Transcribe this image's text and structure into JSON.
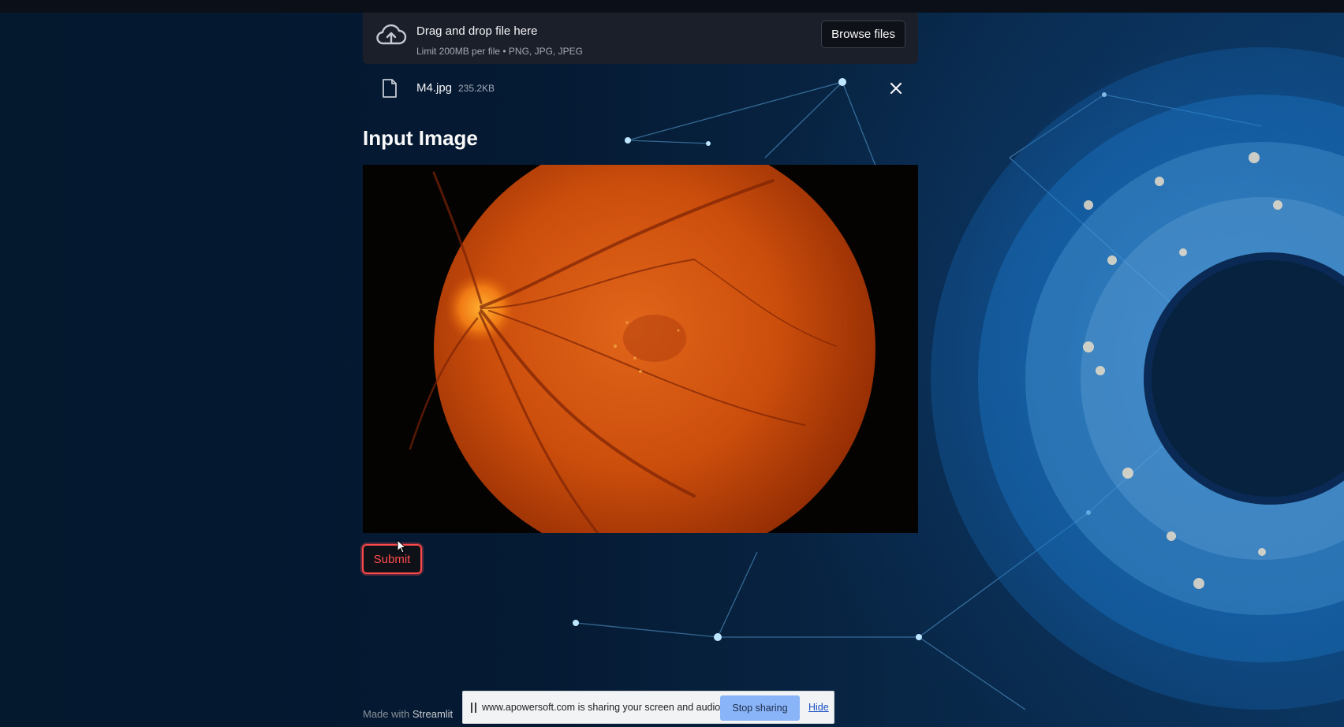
{
  "uploader": {
    "title": "Drag and drop file here",
    "limit_text": "Limit 200MB per file • PNG, JPG, JPEG",
    "browse_label": "Browse files",
    "icon": "cloud-upload-icon"
  },
  "file": {
    "name": "M4.jpg",
    "size": "235.2KB",
    "icon": "file-icon"
  },
  "main": {
    "heading": "Input Image",
    "submit_label": "Submit"
  },
  "footer": {
    "made_with": "Made with",
    "brand": "Streamlit"
  },
  "share_bar": {
    "message": "www.apowersoft.com is sharing your screen and audio.",
    "stop_label": "Stop sharing",
    "hide_label": "Hide"
  },
  "colors": {
    "accent": "#ff4b4b",
    "dropzone_bg": "#1b1f2a",
    "share_button": "#8ab4f8"
  }
}
